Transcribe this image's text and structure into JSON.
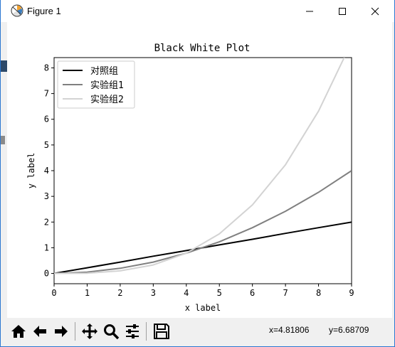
{
  "window": {
    "title": "Figure 1",
    "icon": "matplotlib-figure-icon",
    "controls": [
      "minimize-icon",
      "maximize-icon",
      "close-icon"
    ]
  },
  "toolbar": {
    "buttons": [
      "home-icon",
      "back-arrow-icon",
      "forward-arrow-icon",
      "pan-icon",
      "zoom-icon",
      "subplots-config-icon",
      "save-icon"
    ],
    "coord_x": "x=4.81806",
    "coord_y": "y=6.68709"
  },
  "chart_data": {
    "type": "line",
    "title": "Black White Plot",
    "xlabel": "x label",
    "ylabel": "y label",
    "xlim": [
      0,
      9
    ],
    "ylim": [
      -0.4,
      8.4
    ],
    "xticks": [
      "0",
      "1",
      "2",
      "3",
      "4",
      "5",
      "6",
      "7",
      "8",
      "9"
    ],
    "yticks": [
      "0",
      "1",
      "2",
      "3",
      "4",
      "5",
      "6",
      "7",
      "8"
    ],
    "legend_position": "upper-left",
    "grid": false,
    "x": [
      0,
      1,
      2,
      3,
      4,
      5,
      6,
      7,
      8,
      9
    ],
    "series": [
      {
        "name": "对照组",
        "color": "#000000",
        "values": [
          0.0,
          0.22,
          0.44,
          0.67,
          0.89,
          1.11,
          1.33,
          1.56,
          1.78,
          2.0
        ]
      },
      {
        "name": "实验组1",
        "color": "#808080",
        "values": [
          0.0,
          0.05,
          0.2,
          0.44,
          0.79,
          1.23,
          1.78,
          2.42,
          3.16,
          4.0
        ]
      },
      {
        "name": "实验组2",
        "color": "#d3d3d3",
        "values": [
          0.0,
          0.01,
          0.1,
          0.33,
          0.79,
          1.54,
          2.67,
          4.23,
          6.32,
          9.0
        ]
      }
    ]
  }
}
